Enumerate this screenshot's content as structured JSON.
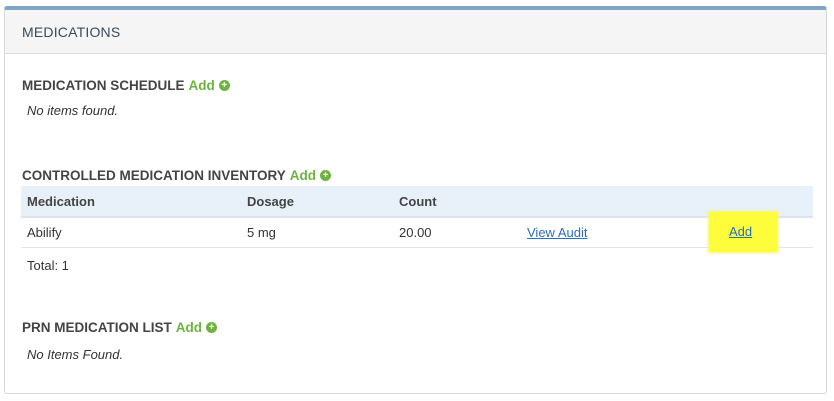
{
  "panel": {
    "title": "MEDICATIONS"
  },
  "schedule": {
    "title": "MEDICATION SCHEDULE",
    "add_label": "Add",
    "empty_text": "No items found."
  },
  "inventory": {
    "title": "CONTROLLED MEDICATION INVENTORY",
    "add_label": "Add",
    "columns": [
      "Medication",
      "Dosage",
      "Count"
    ],
    "rows": [
      {
        "medication": "Abilify",
        "dosage": "5 mg",
        "count": "20.00",
        "view_audit_label": "View Audit",
        "add_label": "Add"
      }
    ],
    "total_text": "Total: 1"
  },
  "prn": {
    "title": "PRN MEDICATION LIST",
    "add_label": "Add",
    "empty_text": "No Items Found."
  },
  "colors": {
    "accent_border": "#7fa6c6",
    "add_green": "#6cb33f",
    "link_blue": "#2a6ebb",
    "highlight_yellow": "#fdfd3c",
    "table_header_bg": "#e8f1fa"
  }
}
